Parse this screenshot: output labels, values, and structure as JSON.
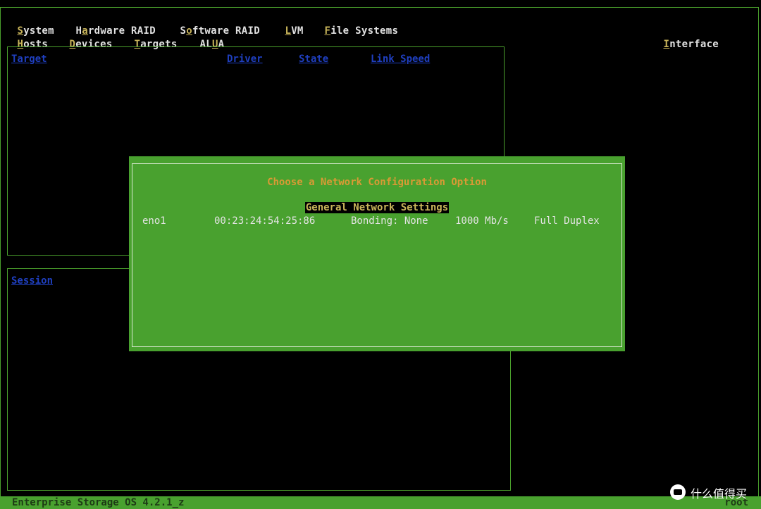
{
  "menu": {
    "row1": [
      {
        "pre": "",
        "hk": "S",
        "post": "ystem"
      },
      {
        "pre": "H",
        "hk": "a",
        "post": "rdware RAID"
      },
      {
        "pre": "S",
        "hk": "o",
        "post": "ftware RAID"
      },
      {
        "pre": "",
        "hk": "L",
        "post": "VM"
      },
      {
        "pre": "",
        "hk": "F",
        "post": "ile Systems"
      }
    ],
    "row2": [
      {
        "pre": "",
        "hk": "H",
        "post": "osts"
      },
      {
        "pre": "",
        "hk": "D",
        "post": "evices"
      },
      {
        "pre": "",
        "hk": "T",
        "post": "argets"
      },
      {
        "pre": "AL",
        "hk": "U",
        "post": "A"
      },
      {
        "pre": "",
        "hk": "I",
        "post": "nterface"
      }
    ]
  },
  "targets_panel": {
    "columns": [
      "Target",
      "Driver",
      "State",
      "Link Speed"
    ]
  },
  "session_panel": {
    "columns": [
      "Session"
    ]
  },
  "dialog": {
    "title": "Choose a Network Configuration Option",
    "heading": "General Network Settings",
    "interface": {
      "name": "eno1",
      "mac": "00:23:24:54:25:86",
      "bonding": "Bonding: None",
      "speed": "1000 Mb/s",
      "duplex": "Full Duplex"
    }
  },
  "status_bar": {
    "product": "Enterprise Storage OS 4.2.1_z",
    "user": "root"
  },
  "watermark": {
    "text": "什么值得买"
  }
}
